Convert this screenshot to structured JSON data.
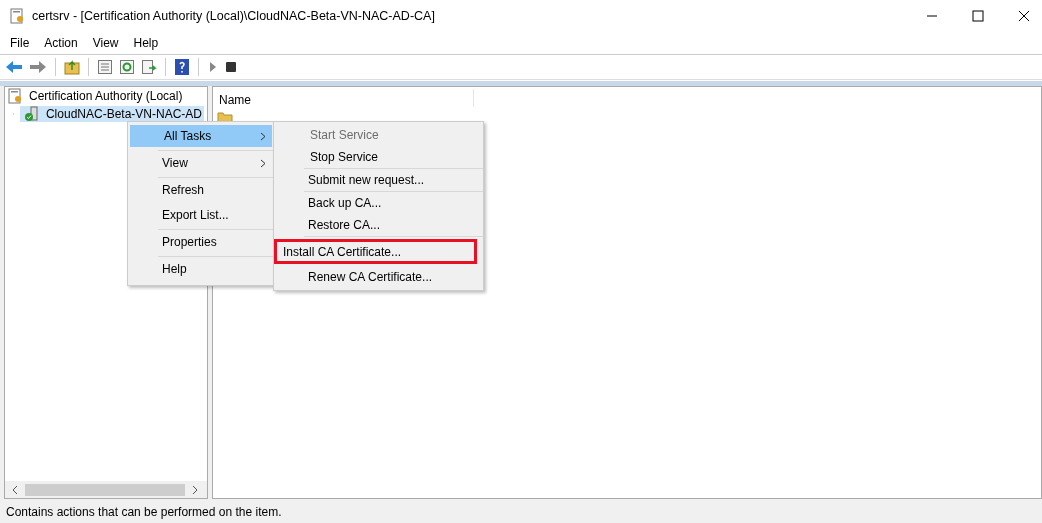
{
  "window": {
    "title": "certsrv - [Certification Authority (Local)\\CloudNAC-Beta-VN-NAC-AD-CA]"
  },
  "menu_bar": [
    "File",
    "Action",
    "View",
    "Help"
  ],
  "tree": {
    "label": "Certification Authority (Local)",
    "children": [
      {
        "label": "CloudNAC-Beta-VN-NAC-AD",
        "selected": true,
        "expanded": false
      }
    ]
  },
  "list": {
    "columns": [
      "Name"
    ]
  },
  "context_menu": {
    "groups": [
      [
        {
          "label": "All Tasks",
          "submenu": true,
          "selected": true
        }
      ],
      [
        {
          "label": "View",
          "submenu": true,
          "selected": false
        }
      ],
      [
        {
          "label": "Refresh",
          "submenu": false,
          "selected": false
        },
        {
          "label": "Export List...",
          "submenu": false,
          "selected": false
        }
      ],
      [
        {
          "label": "Properties",
          "submenu": false,
          "selected": false
        }
      ],
      [
        {
          "label": "Help",
          "submenu": false,
          "selected": false
        }
      ]
    ]
  },
  "submenu": {
    "groups": [
      [
        {
          "label": "Start Service",
          "disabled": true,
          "outlined": false
        },
        {
          "label": "Stop Service",
          "disabled": false,
          "outlined": false
        }
      ],
      [
        {
          "label": "Submit new request...",
          "disabled": false,
          "outlined": false
        }
      ],
      [
        {
          "label": "Back up CA...",
          "disabled": false,
          "outlined": false
        },
        {
          "label": "Restore CA...",
          "disabled": false,
          "outlined": false
        }
      ],
      [
        {
          "label": "Install CA Certificate...",
          "disabled": false,
          "outlined": true
        },
        {
          "label": "Renew CA Certificate...",
          "disabled": false,
          "outlined": false
        }
      ]
    ]
  },
  "status_bar": {
    "text": "Contains actions that can be performed on the item."
  }
}
